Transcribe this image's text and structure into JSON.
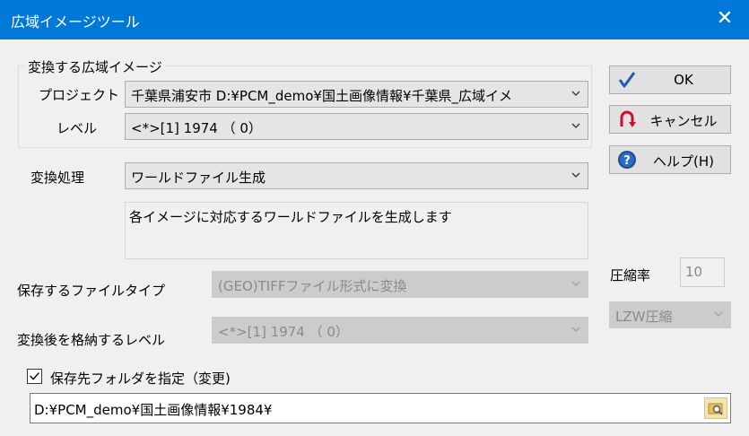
{
  "window": {
    "title": "広域イメージツール",
    "close_symbol": "✕"
  },
  "group": {
    "label": "変換する広域イメージ",
    "project_label": "プロジェクト",
    "project_value": "千葉県浦安市 D:¥PCM_demo¥国土画像情報¥千葉県_広域イメ",
    "level_label": "レベル",
    "level_value": "<*>[1] 1974 （ 0）"
  },
  "process": {
    "label": "変換処理",
    "value": "ワールドファイル生成",
    "description": "各イメージに対応するワールドファイルを生成します"
  },
  "save": {
    "filetype_label": "保存するファイルタイプ",
    "filetype_value": "(GEO)TIFFファイル形式に変換",
    "level_label": "変換後を格納するレベル",
    "level_value": "<*>[1] 1974 （ 0）"
  },
  "compression": {
    "label": "圧縮率",
    "value": "10",
    "method_value": "LZW圧縮"
  },
  "folder": {
    "checkbox_label": "保存先フォルダを指定（変更)",
    "checked": true,
    "path": "D:¥PCM_demo¥国土画像情報¥1984¥"
  },
  "buttons": {
    "ok": "OK",
    "cancel": "キャンセル",
    "help": "ヘルプ(H)"
  },
  "colors": {
    "titlebar": "#0078d7",
    "ok_check": "#1a5fb4",
    "cancel_arrow": "#c8102e",
    "help_circle": "#1f4e8c"
  }
}
